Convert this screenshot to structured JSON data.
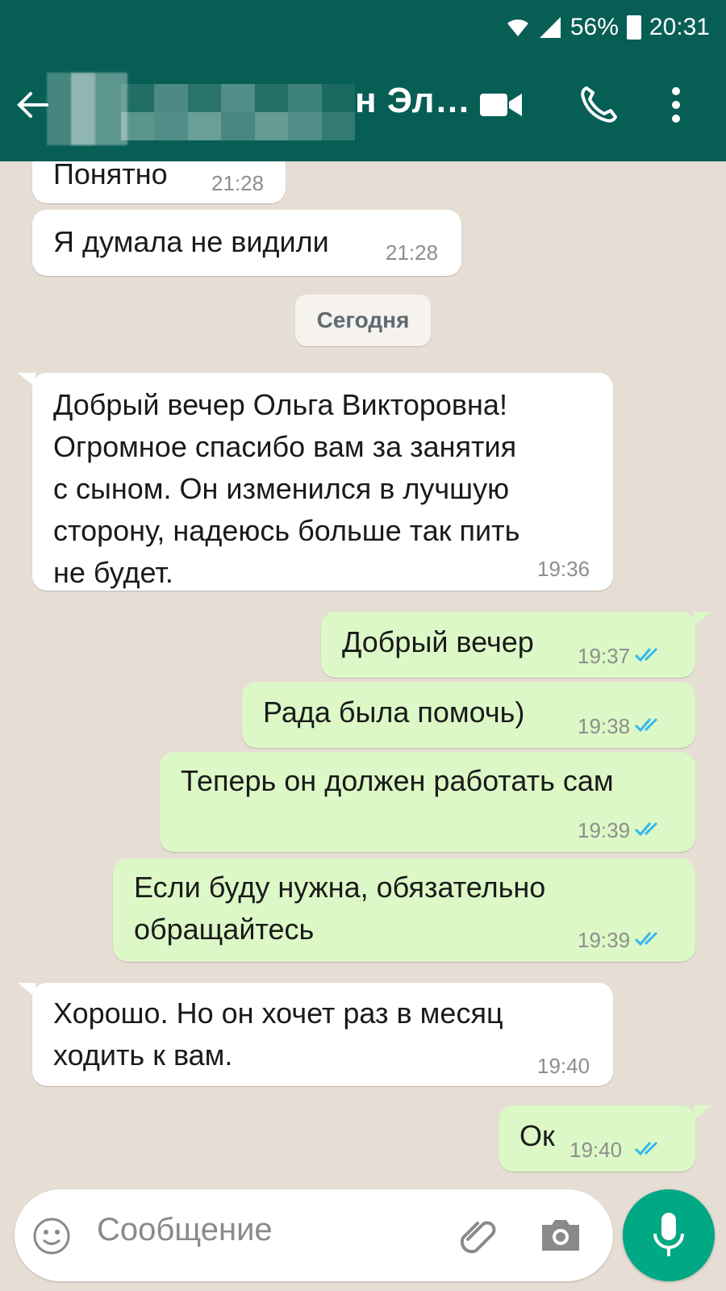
{
  "status_bar": {
    "battery": "56%",
    "time": "20:31"
  },
  "header": {
    "contact_name_visible": "н Эл…"
  },
  "date_separator": "Сегодня",
  "messages": [
    {
      "dir": "in",
      "text": "Понятно",
      "time": "21:28"
    },
    {
      "dir": "in",
      "text": "Я думала не видили",
      "time": "21:28"
    },
    {
      "dir": "in",
      "text": "Добрый вечер Ольга Викторовна!\nОгромное спасибо вам  за занятия\nс сыном.  Он изменился в лучшую\nсторону, надеюсь больше так пить\nне будет.",
      "time": "19:36"
    },
    {
      "dir": "out",
      "text": "Добрый вечер",
      "time": "19:37"
    },
    {
      "dir": "out",
      "text": "Рада была помочь)",
      "time": "19:38"
    },
    {
      "dir": "out",
      "text": "Теперь он должен работать сам",
      "time": "19:39"
    },
    {
      "dir": "out",
      "text": "Если буду нужна, обязательно\nобращайтесь",
      "time": "19:39"
    },
    {
      "dir": "in",
      "text": "Хорошо. Но он хочет раз в месяц\nходить к вам.",
      "time": "19:40"
    },
    {
      "dir": "out",
      "text": "Ок",
      "time": "19:40"
    }
  ],
  "composer": {
    "placeholder": "Сообщение"
  },
  "colors": {
    "header": "#075e54",
    "outgoing_bubble": "#dcf8c6",
    "read_ticks": "#34b7f1",
    "mic_button": "#00a884"
  }
}
